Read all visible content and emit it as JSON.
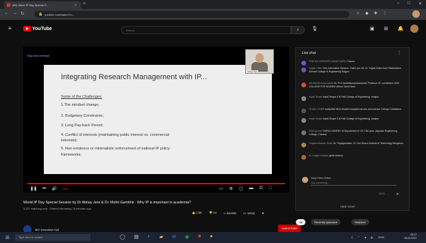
{
  "browser": {
    "tab_title": "(89) World IP Day Special S... ",
    "tab_close": "×",
    "new_tab": "+",
    "url": "youtube.com/watch?v=..."
  },
  "youtube": {
    "logo_text": "YouTube",
    "search_placeholder": "Search"
  },
  "player": {
    "channel_tag": "Bay Area Defense",
    "webcam_name": "Abhay Jere",
    "time_text": "LIVE",
    "progress": 0.99,
    "slide": {
      "title": "Integrating Research Management with IP...",
      "subtitle": "Some of the Challenges:",
      "items": [
        "1.The mindset change;",
        "2. Budgetary Constraints;",
        "3. Long Pay-back Period;",
        "4. Conflict of interests (maintaining public interest  vs.  commercial",
        "interests);",
        "5. Non-existence or minimalistic enforcement of national IP policy",
        "frameworks;"
      ]
    }
  },
  "video": {
    "title": "World IP Day Special Session by Dr Abhay Jere & Dr. Mohit Gambhir : Why IP is important in academia?",
    "meta": "3,237 watching now · Started streaming 75 minutes ago",
    "likes": "1.5K",
    "dislikes": "14",
    "share": "SHARE",
    "save": "SAVE",
    "channel": "MIC Innovation Cell",
    "subscribe": "SUBSCRIBE"
  },
  "chat": {
    "header": "Live chat",
    "messages": [
      {
        "author": "PRATHA VEERAPPA ANNATHURAI",
        "text": "Thanks",
        "color": "#7b4fc8"
      },
      {
        "author": "Yogita Chitre",
        "text": "Very Informative Session. Thank you Sir. Dr. Yogita Chitre from Padmashree Dhiman College of Engineering Nagpur",
        "color": "#7b4fc8"
      },
      {
        "author": "ABHIRAMI Annachelam",
        "text": "Dr. R.G.Senthilkumar/Associate Professor IIC coordinator DKM COLLEGE FOR WOMEN Vellore Tamil Nadu",
        "color": "#d0512d"
      },
      {
        "author": "Anjali Terape",
        "text": "Anjali Terape S B Patil College of Engineering, Indapur",
        "color": "#888"
      },
      {
        "author": "TEJAS CH",
        "text": "IIIT sricity/DAI MCA Student kampalmula anu and science College Coimbatore",
        "color": "#555"
      },
      {
        "author": "Anjali Terape",
        "text": "Anjali Terape S B Patil College of Engineering, Indapur",
        "color": "#888"
      },
      {
        "author": "Silvia guruve",
        "text": "SARVA GANESH. B Department of CE 2 ND year, Jeppiaar Engineering College, Chennai",
        "color": "#777"
      },
      {
        "author": "Thiyaneshwaran Sekar",
        "text": "Dr. Thiyaganesam, Di, Don Bosco Institute of Technology Bengaluru",
        "color": "#aa8844"
      },
      {
        "author": "Dr. Gagan Jodhpur",
        "text": "great session",
        "color": "#aa6633"
      }
    ],
    "input_user": "Nargi Nisha Nailan",
    "input_placeholder": "Say something...",
    "count": "0/200",
    "hide": "HIDE CHAT"
  },
  "chips": [
    "All",
    "Recently uploaded",
    "Watched"
  ],
  "taskbar": {
    "search": "Type here to search",
    "time": "09:17",
    "date": "26-04-2021",
    "lang": "ENG"
  }
}
